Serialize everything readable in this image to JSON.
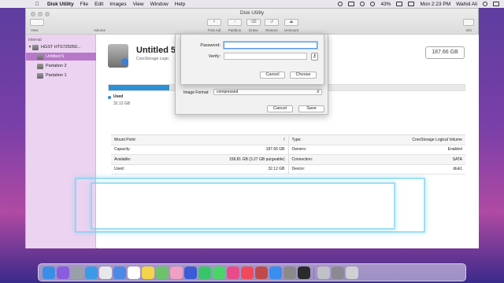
{
  "menubar": {
    "apple": "",
    "items": [
      "Disk Utility",
      "File",
      "Edit",
      "Images",
      "View",
      "Window",
      "Help"
    ],
    "battery": "43%",
    "clock": "Mon 2:23 PM",
    "user": "Wahid Ali"
  },
  "window": {
    "title": "Disk Utility",
    "toolbar": {
      "view_label": "View",
      "volume_label": "Volume",
      "first_aid": "First Aid",
      "partition": "Partition",
      "erase": "Erase",
      "restore": "Restore",
      "unmount": "Unmount",
      "info": "Info"
    }
  },
  "sidebar": {
    "section": "Internal",
    "disk": "HGST HTS725050...",
    "items": [
      "Untitled 5",
      "Partation 2",
      "Partation 1"
    ]
  },
  "volume": {
    "name": "Untitled 5",
    "subtitle": "CoreStorage Logic",
    "size": "187.66 GB",
    "used_label": "Used",
    "used_value": "32.12 GB",
    "used_fraction": 0.17
  },
  "info": {
    "rows": [
      {
        "l_key": "Mount Point:",
        "l_val": "/",
        "r_key": "Type:",
        "r_val": "CoreStorage Logical Volume"
      },
      {
        "l_key": "Capacity:",
        "l_val": "187.66 GB",
        "r_key": "Owners:",
        "r_val": "Enabled"
      },
      {
        "l_key": "Available:",
        "l_val": "158.81 GB (3.27 GB purgeable)",
        "r_key": "Connection:",
        "r_val": "SATA"
      },
      {
        "l_key": "Used:",
        "l_val": "32.12 GB",
        "r_key": "Device:",
        "r_val": "disk1"
      }
    ]
  },
  "save_sheet": {
    "image_format_label": "Image Format:",
    "image_format_value": "compressed",
    "cancel": "Cancel",
    "save": "Save"
  },
  "password_sheet": {
    "password_label": "Password:",
    "verify_label": "Verify:",
    "password_value": "",
    "verify_value": "",
    "cancel": "Cancel",
    "choose": "Choose"
  },
  "dock": {
    "icons": [
      "finder-icon",
      "siri-icon",
      "launchpad-icon",
      "safari-icon",
      "chrome-icon",
      "mail-icon",
      "calendar-icon",
      "notes-icon",
      "maps-icon",
      "photos-icon",
      "bluetooth-icon",
      "facetime-icon",
      "messages-icon",
      "itunes-icon",
      "music-icon",
      "photobooth-icon",
      "app-store-icon",
      "system-preferences-icon",
      "quicktime-icon",
      "disk-utility-icon",
      "screenshot-icon",
      "trash-icon"
    ]
  }
}
